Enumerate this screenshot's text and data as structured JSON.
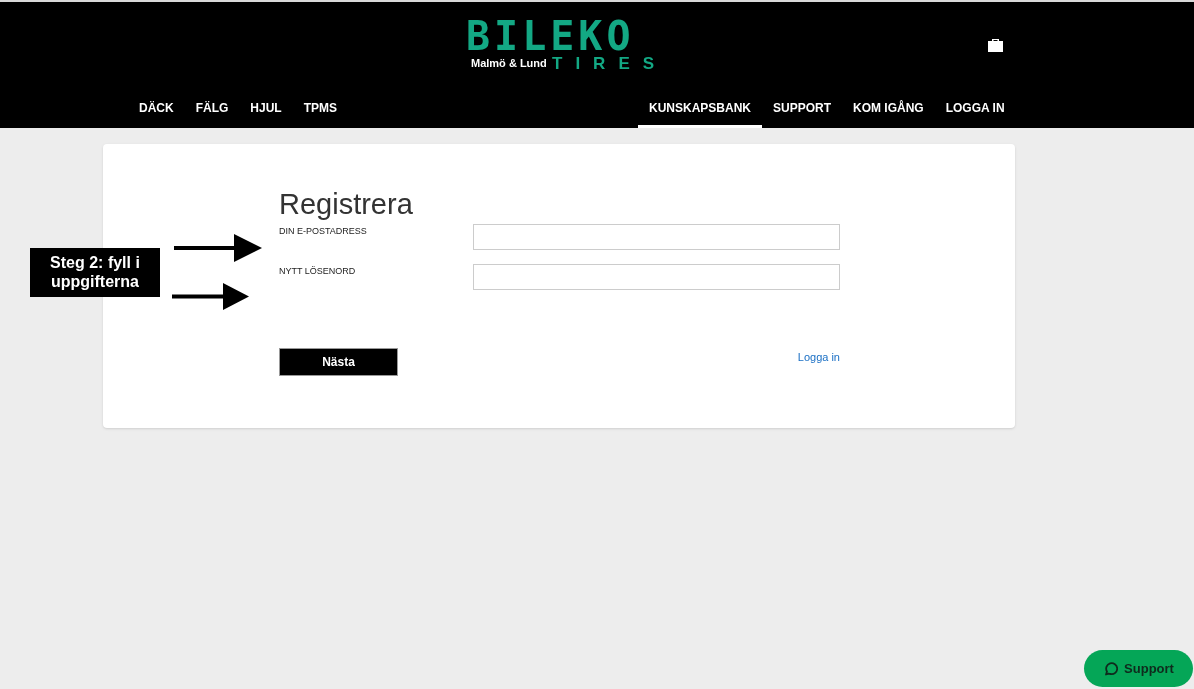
{
  "logo": {
    "wordmark": "BILEKO",
    "location": "Malmö & Lund",
    "subtitle": "TIRES"
  },
  "nav_left": [
    {
      "label": "DÄCK",
      "selected": false
    },
    {
      "label": "FÄLG",
      "selected": false
    },
    {
      "label": "HJUL",
      "selected": false
    },
    {
      "label": "TPMS",
      "selected": false
    }
  ],
  "nav_right": [
    {
      "label": "KUNSKAPSBANK",
      "selected": true
    },
    {
      "label": "SUPPORT",
      "selected": false
    },
    {
      "label": "KOM IGÅNG",
      "selected": false
    },
    {
      "label": "LOGGA IN",
      "selected": false
    }
  ],
  "form": {
    "title": "Registrera",
    "fields": [
      {
        "label": "DIN E-POSTADRESS"
      },
      {
        "label": "NYTT LÖSENORD"
      }
    ],
    "submit": "Nästa",
    "login_link": "Logga in"
  },
  "annotation": {
    "text": "Steg 2: fyll i uppgifterna"
  },
  "support_button": {
    "label": "Support"
  }
}
